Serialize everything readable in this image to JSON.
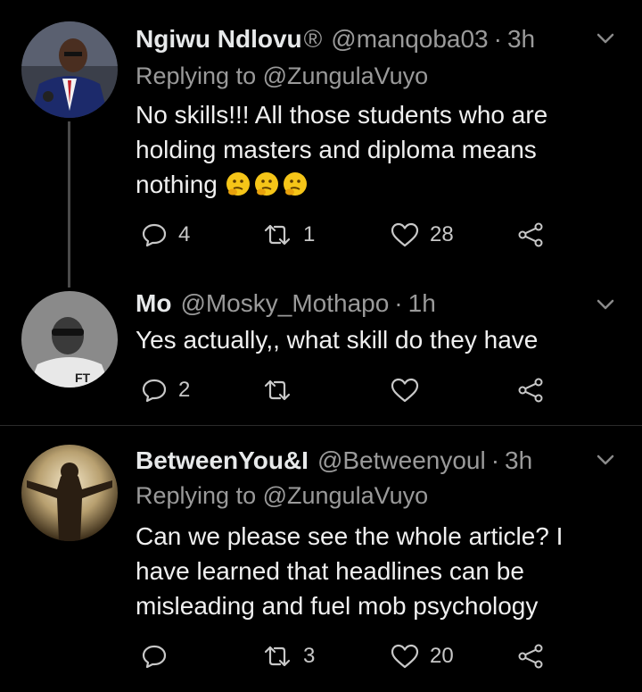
{
  "tweets": [
    {
      "name": "Ngiwu Ndlovu",
      "name_suffix": "®",
      "handle": "@manqoba03",
      "time": "3h",
      "replying_prefix": "Replying to",
      "replying_to": "@ZungulaVuyo",
      "text": "No skills!!! All those students who are holding masters and diploma means nothing",
      "emoji": "thinking-face",
      "emoji_count": 3,
      "replies": "4",
      "retweets": "1",
      "likes": "28"
    },
    {
      "name": "Mo",
      "handle": "@Mosky_Mothapo",
      "time": "1h",
      "text": "Yes actually,, what skill do they have",
      "replies": "2",
      "retweets": "",
      "likes": ""
    },
    {
      "name": "BetweenYou&I",
      "handle": "@Betweenyoul",
      "time": "3h",
      "replying_prefix": "Replying to",
      "replying_to": "@ZungulaVuyo",
      "text": "Can we please see the whole article? I have learned that headlines can be misleading and fuel mob psychology",
      "replies": "",
      "retweets": "3",
      "likes": "20"
    }
  ],
  "icons": [
    "reply-icon",
    "retweet-icon",
    "like-icon",
    "share-icon",
    "chevron-down-icon"
  ],
  "colors": {
    "background": "#000000",
    "text": "#e7e9ea",
    "muted": "#9a9a9a",
    "emoji": "#f5c518"
  }
}
